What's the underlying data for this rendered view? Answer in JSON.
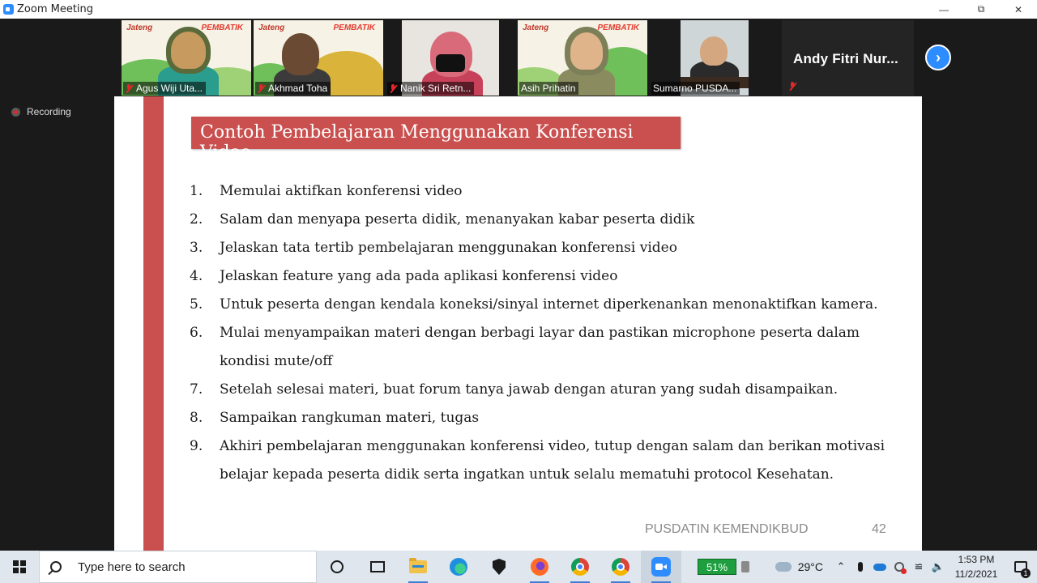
{
  "window": {
    "title": "Zoom Meeting",
    "controls": [
      "minimize",
      "restore",
      "close"
    ]
  },
  "gallery": {
    "participants": [
      {
        "name": "Agus Wiji Uta...",
        "muted": true,
        "active": false
      },
      {
        "name": "Akhmad Toha",
        "muted": true,
        "active": false
      },
      {
        "name": "Nanik Sri Retn...",
        "muted": true,
        "active": false
      },
      {
        "name": "Asih Prihatin",
        "muted": false,
        "active": true
      },
      {
        "name": "Sumarno PUSDA...",
        "muted": false,
        "active": false
      }
    ],
    "name_only_tile": {
      "name": "Andy Fitri Nur...",
      "muted": true
    },
    "next_icon": "chevron-right-icon"
  },
  "recording": {
    "label": "Recording"
  },
  "slide": {
    "title": "Contoh Pembelajaran Menggunakan Konferensi Video",
    "items": [
      {
        "num": "1.",
        "text": "Memulai aktifkan konferensi video"
      },
      {
        "num": "2.",
        "text": "Salam dan menyapa peserta didik, menanyakan kabar peserta didik"
      },
      {
        "num": "3.",
        "text": "Jelaskan tata tertib pembelajaran menggunakan konferensi video"
      },
      {
        "num": "4.",
        "text": "Jelaskan feature yang ada pada aplikasi konferensi video"
      },
      {
        "num": "5.",
        "text": "Untuk peserta dengan kendala koneksi/sinyal internet diperkenankan menonaktifkan kamera."
      },
      {
        "num": "6.",
        "text": "Mulai menyampaikan materi dengan berbagi layar dan pastikan microphone peserta dalam kondisi mute/off"
      },
      {
        "num": "7.",
        "text": "Setelah selesai materi, buat forum tanya jawab dengan aturan yang sudah disampaikan."
      },
      {
        "num": "8.",
        "text": "Sampaikan rangkuman materi, tugas"
      },
      {
        "num": "9.",
        "text": "Akhiri pembelajaran menggunakan konferensi video, tutup dengan salam dan berikan motivasi belajar kepada peserta didik serta ingatkan untuk selalu mematuhi protocol Kesehatan."
      }
    ],
    "footer": "PUSDATIN KEMENDIKBUD",
    "page_number": "42",
    "accent_color": "#c9504e"
  },
  "taskbar": {
    "search_placeholder": "Type here to search",
    "battery": "51%",
    "weather": "29°C",
    "time": "1:53 PM",
    "date": "11/2/2021",
    "notification_count": "1",
    "apps": [
      "cortana-icon",
      "task-view-icon",
      "file-explorer-icon",
      "edge-icon",
      "security-icon",
      "firefox-icon",
      "chrome-icon",
      "chrome-icon",
      "zoom-icon"
    ]
  }
}
